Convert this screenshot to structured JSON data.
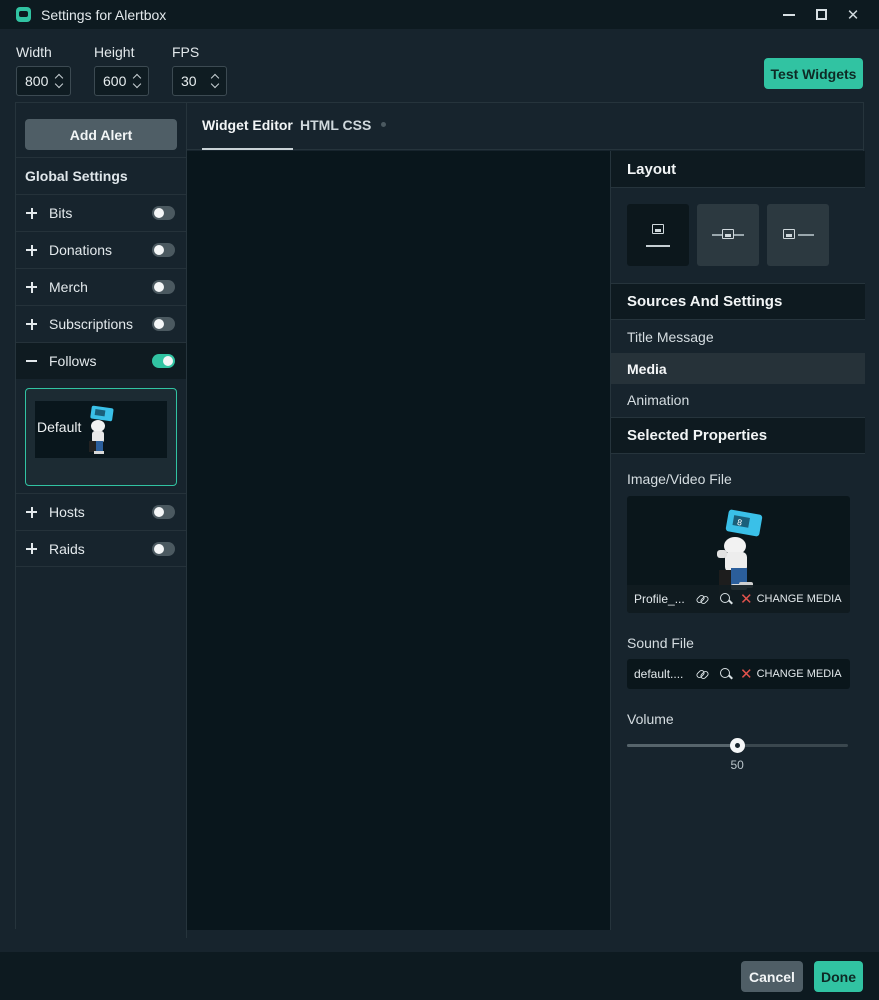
{
  "window": {
    "title": "Settings for Alertbox",
    "icons": {
      "app": "streamlabs-icon",
      "minimize": "minimize-icon",
      "maximize": "maximize-icon",
      "close": "close-icon"
    },
    "close_glyph": "✕"
  },
  "dimensions": {
    "width": {
      "label": "Width",
      "value": "800"
    },
    "height": {
      "label": "Height",
      "value": "600"
    },
    "fps": {
      "label": "FPS",
      "value": "30"
    }
  },
  "toolbar": {
    "test_widgets": "Test Widgets"
  },
  "sidebar": {
    "add_alert": "Add Alert",
    "global_settings": "Global Settings",
    "items": [
      {
        "label": "Bits",
        "enabled": false,
        "expanded": false
      },
      {
        "label": "Donations",
        "enabled": false,
        "expanded": false
      },
      {
        "label": "Merch",
        "enabled": false,
        "expanded": false
      },
      {
        "label": "Subscriptions",
        "enabled": false,
        "expanded": false
      },
      {
        "label": "Follows",
        "enabled": true,
        "expanded": true
      },
      {
        "label": "Hosts",
        "enabled": false,
        "expanded": false
      },
      {
        "label": "Raids",
        "enabled": false,
        "expanded": false
      }
    ],
    "variation": {
      "label": "Default"
    }
  },
  "tabs": [
    {
      "label": "Widget Editor",
      "active": true
    },
    {
      "label": "HTML CSS",
      "active": false
    }
  ],
  "settings": {
    "layout": {
      "title": "Layout",
      "options": [
        "image-top-text-bottom",
        "text-over-image",
        "image-left-text-right"
      ],
      "selected": 0
    },
    "sources": {
      "title": "Sources And Settings",
      "items": [
        {
          "label": "Title Message",
          "active": false
        },
        {
          "label": "Media",
          "active": true
        },
        {
          "label": "Animation",
          "active": false
        }
      ]
    },
    "selected_properties": {
      "title": "Selected Properties",
      "image_file": {
        "label": "Image/Video File",
        "file_name": "Profile_...",
        "change_label": "CHANGE MEDIA"
      },
      "sound_file": {
        "label": "Sound File",
        "file_name": "default....",
        "change_label": "CHANGE MEDIA"
      },
      "volume": {
        "label": "Volume",
        "value": 50,
        "display": "50"
      }
    }
  },
  "footer": {
    "cancel": "Cancel",
    "done": "Done"
  },
  "colors": {
    "accent": "#31c3a2",
    "background": "#17242d",
    "dark": "#09161c",
    "danger": "#e0524c"
  }
}
